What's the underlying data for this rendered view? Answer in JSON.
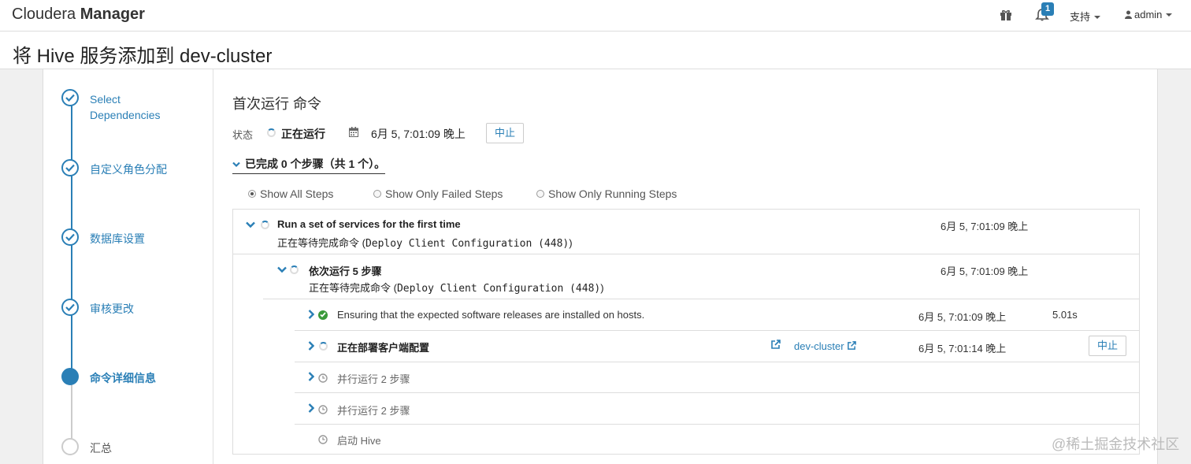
{
  "header": {
    "brand_light": "Cloudera ",
    "brand_bold": "Manager",
    "notifications_count": "1",
    "support_label": "支持",
    "user_label": "admin"
  },
  "page": {
    "title": "将 Hive 服务添加到 dev-cluster"
  },
  "wizard": {
    "steps": [
      {
        "label_line1": "Select",
        "label_line2": "Dependencies",
        "state": "done"
      },
      {
        "label": "自定义角色分配",
        "state": "done"
      },
      {
        "label": "数据库设置",
        "state": "done"
      },
      {
        "label": "审核更改",
        "state": "done"
      },
      {
        "label": "命令详细信息",
        "state": "active"
      },
      {
        "label": "汇总",
        "state": "pending"
      }
    ]
  },
  "command": {
    "title": "首次运行 命令",
    "status_label": "状态",
    "status_value": "正在运行",
    "time": "6月 5, 7:01:09 晚上",
    "abort_label": "中止",
    "completed_summary": "已完成 0 个步骤（共 1 个）。"
  },
  "filters": {
    "all": "Show All Steps",
    "failed": "Show Only Failed Steps",
    "running": "Show Only Running Steps",
    "selected": "all"
  },
  "steps": {
    "root": {
      "title": "Run a set of services for the first time",
      "sub_prefix": "正在等待完成命令 (",
      "sub_mono": "Deploy Client Configuration (448)",
      "sub_suffix": ")",
      "time": "6月 5, 7:01:09 晚上"
    },
    "seq": {
      "title": "依次运行 5 步骤",
      "sub_prefix": "正在等待完成命令 (",
      "sub_mono": "Deploy Client Configuration (448)",
      "sub_suffix": ")",
      "time": "6月 5, 7:01:09 晚上"
    },
    "items": [
      {
        "desc": "Ensuring that the expected software releases are installed on hosts.",
        "time": "6月 5, 7:01:09 晚上",
        "duration": "5.01s"
      },
      {
        "desc": "正在部署客户端配置",
        "cluster": "dev-cluster",
        "time": "6月 5, 7:01:14 晚上",
        "abort_label": "中止"
      },
      {
        "desc": "并行运行 2 步骤"
      },
      {
        "desc": "并行运行 2 步骤"
      },
      {
        "desc": "启动 Hive"
      }
    ]
  },
  "watermark": "@稀土掘金技术社区",
  "colors": {
    "accent": "#2a7fb6",
    "success": "#3a9a3a"
  }
}
